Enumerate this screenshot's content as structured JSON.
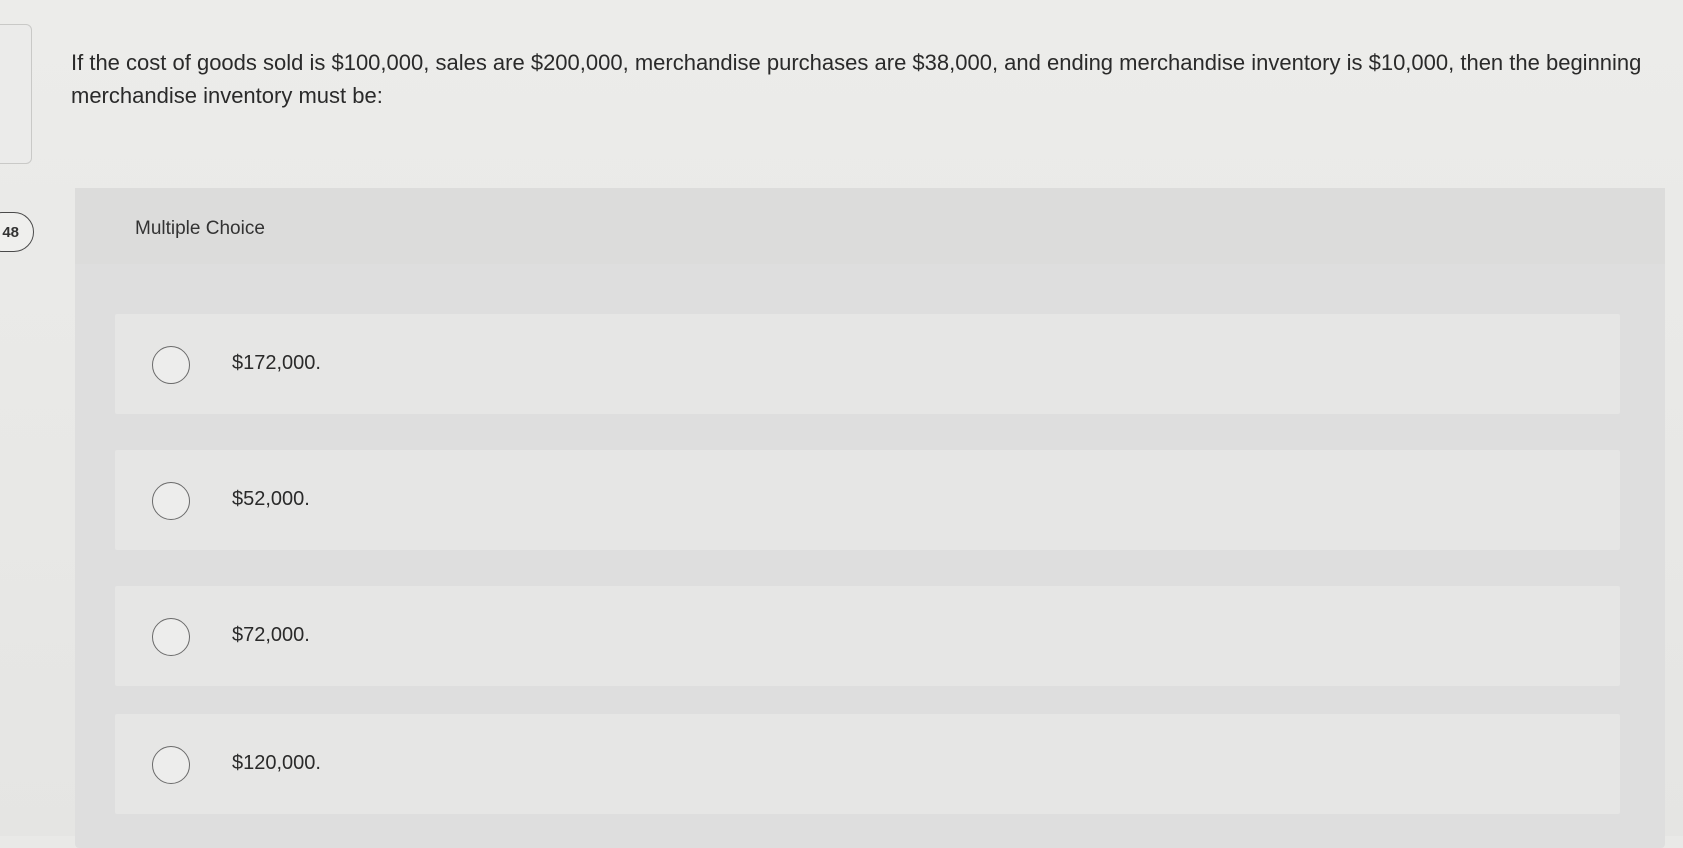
{
  "question": {
    "number": "48",
    "text": "If the cost of goods sold is $100,000, sales are $200,000, merchandise purchases are $38,000, and ending merchandise inventory is $10,000, then the beginning merchandise inventory must be:"
  },
  "multiple_choice": {
    "title": "Multiple Choice",
    "options": [
      {
        "label": "$172,000."
      },
      {
        "label": "$52,000."
      },
      {
        "label": "$72,000."
      },
      {
        "label": "$120,000."
      }
    ]
  }
}
